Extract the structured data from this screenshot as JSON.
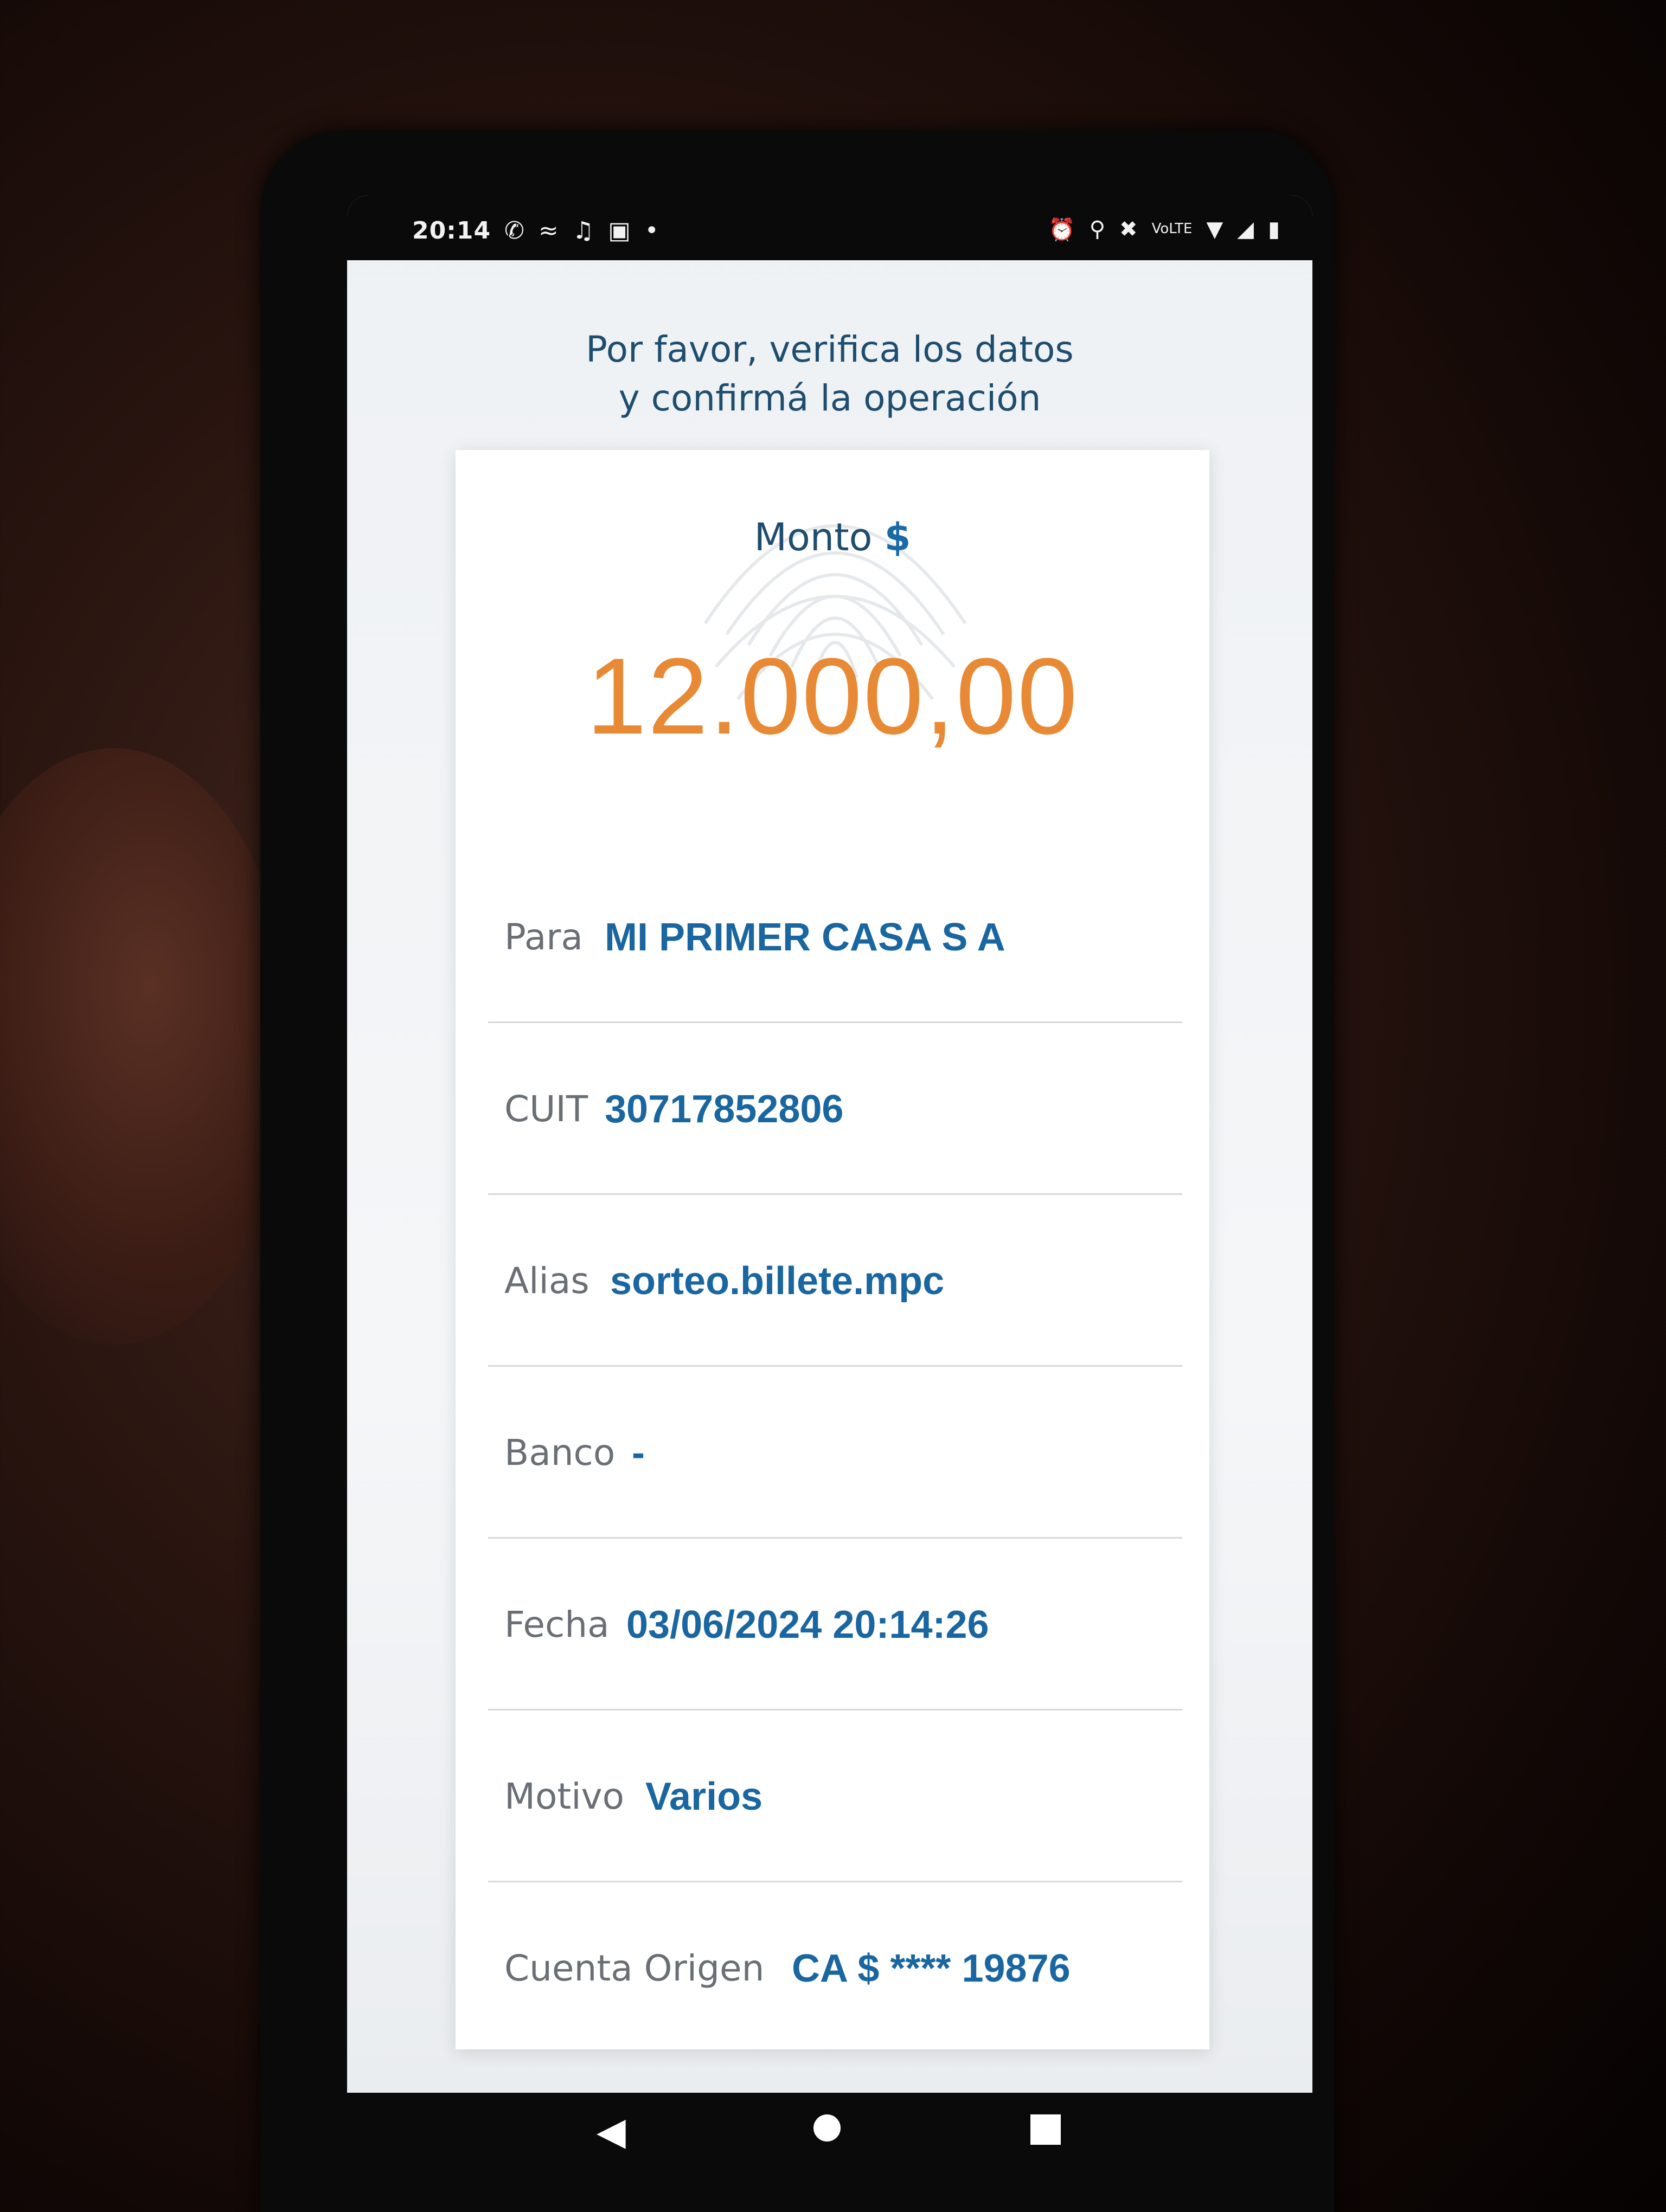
{
  "status_bar": {
    "time": "20:14",
    "left_icons": [
      "whatsapp-icon",
      "bird-icon",
      "tiktok-icon",
      "u-app-icon",
      "dot-icon"
    ],
    "right_icons": [
      "alarm-icon",
      "location-icon",
      "mute-icon",
      "volte-icon",
      "wifi-icon",
      "signal-icon",
      "battery-icon"
    ],
    "network": "VoLTE"
  },
  "prompt": {
    "line1": "Por favor, verifica los datos",
    "line2": "y confirmá la operación"
  },
  "amount": {
    "label": "Monto",
    "currency": "$",
    "value": "12.000,00"
  },
  "details": [
    {
      "label": "Para",
      "value": "MI PRIMER CASA S A"
    },
    {
      "label": "CUIT",
      "value": "30717852806"
    },
    {
      "label": "Alias",
      "value": "sorteo.billete.mpc"
    },
    {
      "label": "Banco",
      "value": "-"
    },
    {
      "label": "Fecha",
      "value": "03/06/2024 20:14:26"
    },
    {
      "label": "Motivo",
      "value": "Varios"
    },
    {
      "label": "Cuenta Origen",
      "value": "CA $ **** 19876"
    }
  ],
  "colors": {
    "primary_text": "#1f4d6e",
    "value_blue": "#1a66a0",
    "amount_orange": "#e88a35",
    "label_gray": "#6a6f75"
  }
}
